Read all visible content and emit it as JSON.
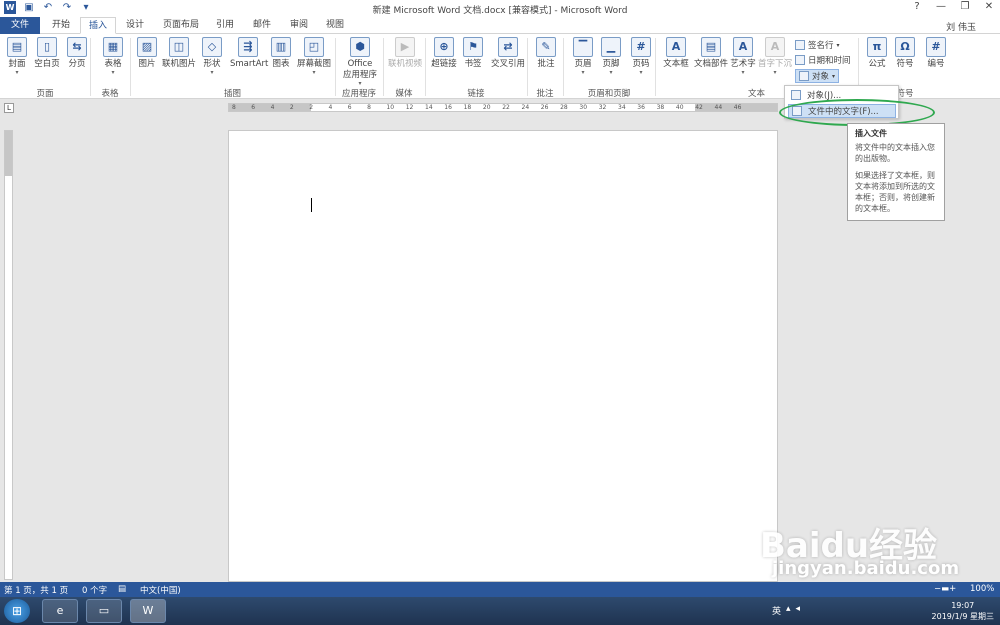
{
  "window": {
    "title": "新建 Microsoft Word 文档.docx [兼容模式] - Microsoft Word",
    "user": "刘 伟玉",
    "help": "?",
    "controls": [
      "—",
      "❐",
      "✕"
    ]
  },
  "qat": {
    "logo": "W",
    "save": "▣",
    "undo": "↶",
    "redo": "↷",
    "more": "▾"
  },
  "tabs": [
    "文件",
    "开始",
    "插入",
    "设计",
    "页面布局",
    "引用",
    "邮件",
    "审阅",
    "视图"
  ],
  "ribbon": {
    "buttons": [
      {
        "label": "封面",
        "icon": "cover-page-icon",
        "glyph": "▤"
      },
      {
        "label": "空白页",
        "icon": "blank-page-icon",
        "glyph": "▯"
      },
      {
        "label": "分页",
        "icon": "page-break-icon",
        "glyph": "⇆"
      },
      {
        "label": "表格",
        "icon": "table-icon",
        "glyph": "▦"
      },
      {
        "label": "图片",
        "icon": "picture-icon",
        "glyph": "▨"
      },
      {
        "label": "联机图片",
        "icon": "online-picture-icon",
        "glyph": "◫"
      },
      {
        "label": "形状",
        "icon": "shapes-icon",
        "glyph": "◇"
      },
      {
        "label": "SmartArt",
        "icon": "smartart-icon",
        "glyph": "⇶"
      },
      {
        "label": "图表",
        "icon": "chart-icon",
        "glyph": "▥"
      },
      {
        "label": "屏幕截图",
        "icon": "screenshot-icon",
        "glyph": "◰"
      },
      {
        "label": "Office\n应用程序",
        "icon": "office-apps-icon",
        "glyph": "⬢"
      },
      {
        "label": "联机视频",
        "icon": "online-video-icon",
        "glyph": "▶"
      },
      {
        "label": "超链接",
        "icon": "hyperlink-icon",
        "glyph": "⊕"
      },
      {
        "label": "书签",
        "icon": "bookmark-icon",
        "glyph": "⚑"
      },
      {
        "label": "交叉引用",
        "icon": "cross-reference-icon",
        "glyph": "⇄"
      },
      {
        "label": "批注",
        "icon": "comment-icon",
        "glyph": "✎"
      },
      {
        "label": "页眉",
        "icon": "header-icon",
        "glyph": "▔"
      },
      {
        "label": "页脚",
        "icon": "footer-icon",
        "glyph": "▁"
      },
      {
        "label": "页码",
        "icon": "page-number-icon",
        "glyph": "#"
      },
      {
        "label": "文本框",
        "icon": "text-box-icon",
        "glyph": "A"
      },
      {
        "label": "文档部件",
        "icon": "quick-parts-icon",
        "glyph": "▤"
      },
      {
        "label": "艺术字",
        "icon": "wordart-icon",
        "glyph": "A"
      },
      {
        "label": "首字下沉",
        "icon": "drop-cap-icon",
        "glyph": "A"
      },
      {
        "label": "公式",
        "icon": "equation-icon",
        "glyph": "π"
      },
      {
        "label": "符号",
        "icon": "symbol-icon",
        "glyph": "Ω"
      },
      {
        "label": "编号",
        "icon": "number-icon",
        "glyph": "#"
      }
    ],
    "groups": [
      "页面",
      "表格",
      "插图",
      "应用程序",
      "媒体",
      "链接",
      "批注",
      "页眉和页脚",
      "文本",
      "符号"
    ],
    "small": {
      "signature": "签名行",
      "datetime": "日期和时间",
      "object": "对象"
    }
  },
  "ruler": {
    "numbers": [
      "8",
      "6",
      "4",
      "2",
      "2",
      "4",
      "6",
      "8",
      "10",
      "12",
      "14",
      "16",
      "18",
      "20",
      "22",
      "24",
      "26",
      "28",
      "30",
      "32",
      "34",
      "36",
      "38",
      "40",
      "42",
      "44",
      "46"
    ]
  },
  "dropdown": {
    "items": [
      {
        "label": "对象(J)..."
      },
      {
        "label": "文件中的文字(F)..."
      }
    ]
  },
  "tooltip": {
    "title": "插入文件",
    "p1": "将文件中的文本插入您的出版物。",
    "p2": "如果选择了文本框，则文本将添加到所选的文本框；否则，将创建新的文本框。"
  },
  "status": {
    "page": "第 1 页，共 1 页",
    "words": "0 个字",
    "lang": "中文(中国)",
    "zoom": "100%"
  },
  "taskbar": {
    "time": "19:07",
    "date": "2019/1/9 星期三",
    "ime": "英"
  },
  "watermark": {
    "line1": "Baidu经验",
    "line2": "jingyan.baidu.com"
  }
}
